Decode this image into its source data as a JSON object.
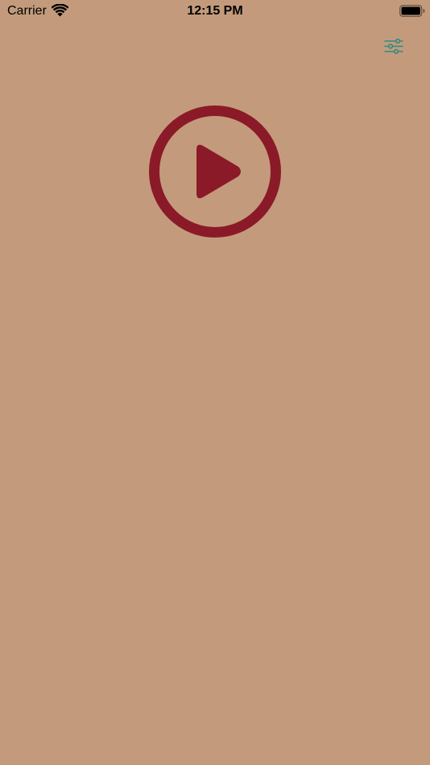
{
  "status_bar": {
    "carrier": "Carrier",
    "time": "12:15 PM"
  },
  "colors": {
    "background": "#C39B7C",
    "play_accent": "#8B1A28",
    "settings_accent": "#2E8B84"
  },
  "icons": {
    "wifi": "wifi-icon",
    "battery": "battery-icon",
    "settings": "sliders-icon",
    "play": "play-icon"
  }
}
